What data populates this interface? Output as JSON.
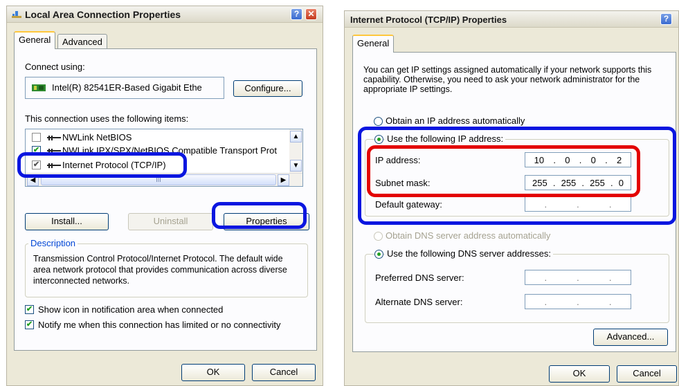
{
  "left_dialog": {
    "title": "Local Area Connection Properties",
    "help_glyph": "?",
    "close_glyph": "✕",
    "tabs": [
      "General",
      "Advanced"
    ],
    "connect_using_label": "Connect using:",
    "adapter_name": "Intel(R) 82541ER-Based Gigabit Ethe",
    "configure_button": "Configure...",
    "items_label": "This connection uses the following items:",
    "items": [
      {
        "label": "NWLink NetBIOS",
        "checked": false
      },
      {
        "label": "NWLink IPX/SPX/NetBIOS Compatible Transport Prot",
        "checked": true
      },
      {
        "label": "Internet Protocol (TCP/IP)",
        "checked": true
      }
    ],
    "hscroll_grip": "III",
    "install_button": "Install...",
    "uninstall_button": "Uninstall",
    "properties_button": "Properties",
    "description_legend": "Description",
    "description_text": "Transmission Control Protocol/Internet Protocol. The default wide area network protocol that provides communication across diverse interconnected networks.",
    "show_icon_label": "Show icon in notification area when connected",
    "notify_label": "Notify me when this connection has limited or no connectivity",
    "ok_button": "OK",
    "cancel_button": "Cancel"
  },
  "right_dialog": {
    "title": "Internet Protocol (TCP/IP) Properties",
    "help_glyph": "?",
    "close_glyph": "✕",
    "tab": "General",
    "intro_text": "You can get IP settings assigned automatically if your network supports this capability. Otherwise, you need to ask your network administrator for the appropriate IP settings.",
    "obtain_auto_label": "Obtain an IP address automatically",
    "use_following_label": "Use the following IP address:",
    "ip_label": "IP address:",
    "ip_octets": [
      "10",
      "0",
      "0",
      "2"
    ],
    "subnet_label": "Subnet mask:",
    "subnet_octets": [
      "255",
      "255",
      "255",
      "0"
    ],
    "gateway_label": "Default gateway:",
    "dot": ".",
    "obtain_dns_label": "Obtain DNS server address automatically",
    "use_dns_label": "Use the following DNS server addresses:",
    "preferred_dns_label": "Preferred DNS server:",
    "alternate_dns_label": "Alternate DNS server:",
    "advanced_button": "Advanced...",
    "ok_button": "OK",
    "cancel_button": "Cancel"
  },
  "colors": {
    "highlight_blue": "#0a16e0",
    "highlight_red": "#e30000",
    "dialog_bg": "#ece9d8",
    "panel_bg": "#fcfcfe",
    "check_green": "#21a121"
  },
  "icons": [
    "network-connection-icon",
    "network-adapter-icon",
    "network-component-icon",
    "help-icon",
    "close-icon",
    "scroll-up-icon",
    "scroll-down-icon",
    "scroll-left-icon",
    "scroll-right-icon"
  ]
}
